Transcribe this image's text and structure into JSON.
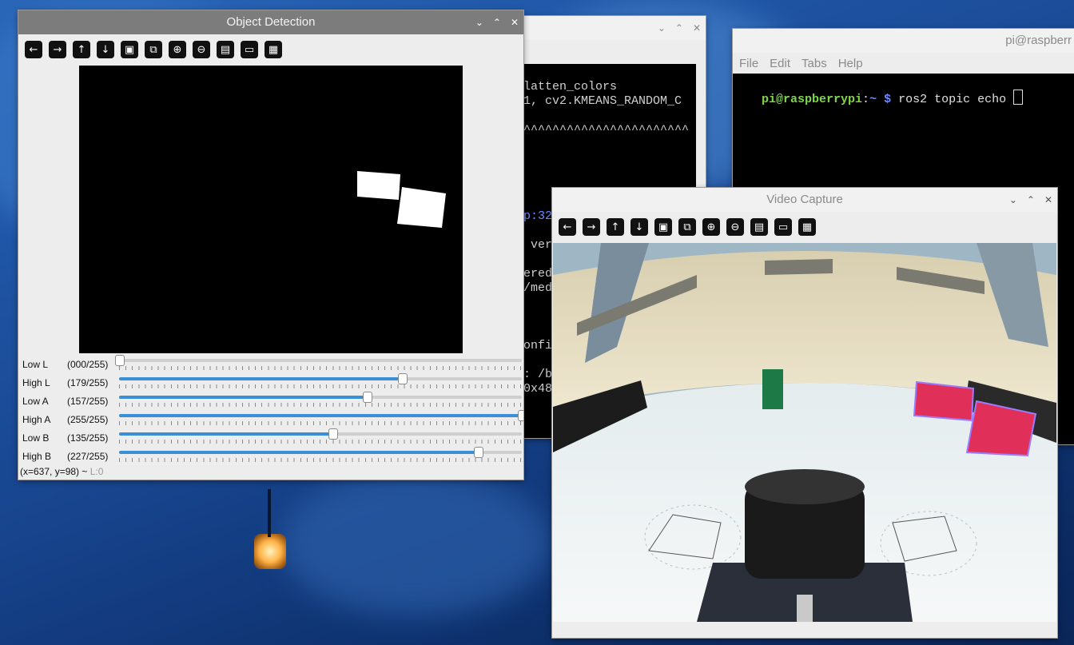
{
  "desktop": {
    "accent": "#1f55a5"
  },
  "terminal_back": {
    "lines": [
      "latten_colors",
      "1, cv2.KMEANS_RANDOM_C",
      "",
      "^^^^^^^^^^^^^^^^^^^^^^^",
      "",
      "",
      "",
      "",
      "",
      "p:32",
      "",
      " ver",
      "",
      "ered",
      "/med",
      "",
      "",
      "",
      "onfi",
      "",
      ": /b",
      "0x48"
    ]
  },
  "terminal_right": {
    "title": "pi@raspberr",
    "menu": [
      "File",
      "Edit",
      "Tabs",
      "Help"
    ],
    "prompt_user": "pi@raspberrypi",
    "prompt_sep": ":",
    "prompt_path": "~",
    "prompt_symbol": "$",
    "command": "ros2 topic echo"
  },
  "object_detection": {
    "title": "Object Detection",
    "toolbar_icons": [
      "arrow-left-icon",
      "arrow-right-icon",
      "arrow-up-icon",
      "arrow-down-icon",
      "image-icon",
      "image-search-icon",
      "zoom-in-icon",
      "zoom-out-icon",
      "save-icon",
      "clipboard-icon",
      "brush-icon"
    ],
    "sliders": [
      {
        "name": "Low L",
        "value_label": "(000/255)",
        "value": 0
      },
      {
        "name": "High L",
        "value_label": "(179/255)",
        "value": 179
      },
      {
        "name": "Low A",
        "value_label": "(157/255)",
        "value": 157
      },
      {
        "name": "High A",
        "value_label": "(255/255)",
        "value": 255
      },
      {
        "name": "Low B",
        "value_label": "(135/255)",
        "value": 135
      },
      {
        "name": "High B",
        "value_label": "(227/255)",
        "value": 227
      }
    ],
    "status_coords": "(x=637, y=98) ~",
    "status_level": "L:0"
  },
  "video_capture": {
    "title": "Video Capture",
    "toolbar_icons": [
      "arrow-left-icon",
      "arrow-right-icon",
      "arrow-up-icon",
      "arrow-down-icon",
      "image-icon",
      "image-search-icon",
      "zoom-in-icon",
      "zoom-out-icon",
      "save-icon",
      "clipboard-icon",
      "brush-icon"
    ]
  },
  "window_controls": {
    "minimize": "⌄",
    "maximize": "⌃",
    "close": "✕"
  }
}
